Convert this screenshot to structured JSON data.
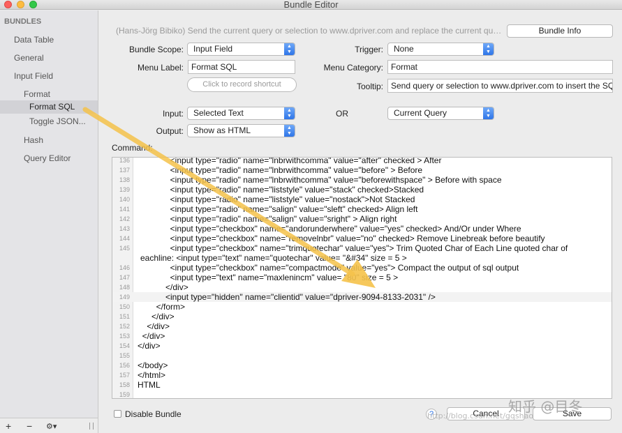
{
  "window": {
    "title": "Bundle Editor"
  },
  "sidebar": {
    "header": "BUNDLES",
    "items": [
      {
        "label": "Data Table"
      },
      {
        "label": "General"
      },
      {
        "label": "Input Field"
      },
      {
        "label": "Format"
      },
      {
        "label": "Format SQL"
      },
      {
        "label": "Toggle JSON..."
      },
      {
        "label": "Hash"
      },
      {
        "label": "Query Editor"
      }
    ],
    "add_label": "+",
    "remove_label": "−",
    "gear_label": "⚙▾"
  },
  "main": {
    "description": "(Hans-Jörg Bibiko) Send the current query or selection to www.dpriver.com and replace the current que...",
    "bundle_info_label": "Bundle Info",
    "bundle_scope_label": "Bundle Scope:",
    "bundle_scope_value": "Input Field",
    "trigger_label": "Trigger:",
    "trigger_value": "None",
    "menu_label_label": "Menu Label:",
    "menu_label_value": "Format SQL",
    "menu_category_label": "Menu Category:",
    "menu_category_value": "Format",
    "shortcut_placeholder": "Click to record shortcut",
    "tooltip_label": "Tooltip:",
    "tooltip_value": "Send query or selection to www.dpriver.com to insert the SQ",
    "input_label": "Input:",
    "input_value": "Selected Text",
    "or_label": "OR",
    "input_fallback_value": "Current Query",
    "output_label": "Output:",
    "output_value": "Show as HTML",
    "command_label": "Command:",
    "disable_bundle_label": "Disable Bundle",
    "help_label": "?",
    "cancel_label": "Cancel",
    "save_label": "Save"
  },
  "code_lines": [
    {
      "num": "136",
      "text": "              <input type=\"radio\" name=\"lnbrwithcomma\" value=\"after\" checked > After"
    },
    {
      "num": "137",
      "text": "              <input type=\"radio\" name=\"lnbrwithcomma\" value=\"before\" > Before"
    },
    {
      "num": "138",
      "text": "              <input type=\"radio\" name=\"lnbrwithcomma\" value=\"beforewithspace\" > Before with space"
    },
    {
      "num": "139",
      "text": "              <input type=\"radio\" name=\"liststyle\" value=\"stack\" checked>Stacked"
    },
    {
      "num": "140",
      "text": "              <input type=\"radio\" name=\"liststyle\" value=\"nostack\">Not Stacked"
    },
    {
      "num": "141",
      "text": "              <input type=\"radio\" name=\"salign\" value=\"sleft\" checked> Align left"
    },
    {
      "num": "142",
      "text": "              <input type=\"radio\" name=\"salign\" value=\"sright\" > Align right"
    },
    {
      "num": "143",
      "text": "              <input type=\"checkbox\" name=\"andorunderwhere\" value=\"yes\" checked> And/Or under Where"
    },
    {
      "num": "144",
      "text": "              <input type=\"checkbox\" name=\"removelnbr\" value=\"no\" checked> Remove Linebreak before beautify"
    },
    {
      "num": "145",
      "text": "              <input type=\"checkbox\" name=\"trimquotechar\" value=\"yes\"> Trim Quoted Char of Each Line quoted char of"
    },
    {
      "num": "",
      "text": "eachline: <input type=\"text\" name=\"quotechar\" value= \"&#34\" size = 5 >"
    },
    {
      "num": "146",
      "text": "              <input type=\"checkbox\" name=\"compactmode\" value=\"yes\"> Compact the output of sql output"
    },
    {
      "num": "147",
      "text": "              <input type=\"text\" name=\"maxlenincm\" value= \"80\" size = 5 >"
    },
    {
      "num": "148",
      "text": "            </div>"
    },
    {
      "num": "149",
      "text": "            <input type=\"hidden\" name=\"clientid\" value=\"dpriver-9094-8133-2031\" />"
    },
    {
      "num": "150",
      "text": "        </form>"
    },
    {
      "num": "151",
      "text": "      </div>"
    },
    {
      "num": "152",
      "text": "    </div>"
    },
    {
      "num": "153",
      "text": "  </div>"
    },
    {
      "num": "154",
      "text": "</div>"
    },
    {
      "num": "155",
      "text": ""
    },
    {
      "num": "156",
      "text": "</body>"
    },
    {
      "num": "157",
      "text": "</html>"
    },
    {
      "num": "158",
      "text": "HTML"
    },
    {
      "num": "159",
      "text": ""
    }
  ],
  "watermark": {
    "zhihu": "知乎 @目冬",
    "url": "http://blog.csdn.net/gqshao"
  },
  "colors": {
    "accent": "#2f75e8",
    "annotation_arrow": "#f5c24a",
    "selection": "#d2d2d6"
  }
}
